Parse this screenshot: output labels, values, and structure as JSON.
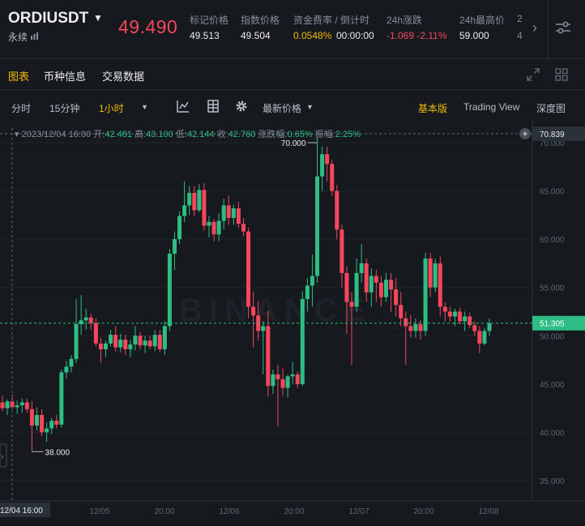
{
  "header": {
    "symbol": "ORDIUSDT",
    "contract_type": "永续",
    "last_price": "49.490",
    "stats": [
      {
        "label": "标记价格",
        "value": "49.513",
        "color": "#eaecef"
      },
      {
        "label": "指数价格",
        "value": "49.504",
        "color": "#eaecef"
      },
      {
        "label": "资金费率 / 倒计时",
        "value": "0.0548%",
        "value2": "00:00:00",
        "color": "#f0b90b"
      },
      {
        "label": "24h涨跌",
        "value": "-1.069 -2.11%",
        "color": "#f6465d"
      },
      {
        "label": "24h最高价",
        "value": "59.000",
        "color": "#eaecef"
      },
      {
        "label": "2",
        "value": "4",
        "color": "#848e9c"
      }
    ]
  },
  "tabs": [
    "图表",
    "币种信息",
    "交易数据"
  ],
  "toolbar": {
    "intervals": [
      "分时",
      "15分钟",
      "1小时"
    ],
    "price_type": "最新价格",
    "views": [
      "基本版",
      "Trading View",
      "深度图"
    ]
  },
  "ohlc": {
    "datetime": "2023/12/04 16:00",
    "open_label": "开:",
    "open": "42.481",
    "high_label": "高:",
    "high": "43.100",
    "low_label": "低:",
    "low": "42.144",
    "close_label": "收:",
    "close": "42.760",
    "change_label": "涨跌幅:",
    "change": "0.65%",
    "amplitude_label": "振幅:",
    "amplitude": "2.25%"
  },
  "chart_data": {
    "type": "candlestick",
    "watermark": "BINANCE",
    "y_ticks": [
      "70.000",
      "65.000",
      "60.000",
      "55.000",
      "50.000",
      "45.000",
      "40.000",
      "35.000"
    ],
    "ylim": [
      33.5,
      71.2
    ],
    "x_ticks": [
      "12/05",
      "20:00",
      "12/06",
      "20:00",
      "12/07",
      "20:00",
      "12/08"
    ],
    "crosshair_time": "12/04 16:00",
    "crosshair_price": "70.839",
    "last_price_tag": "51.305",
    "annotations": [
      {
        "text": "70.000",
        "price": 70.0
      },
      {
        "text": "38.000",
        "price": 38.0
      }
    ],
    "colors": {
      "up": "#2ebd85",
      "down": "#f6465d"
    },
    "candles": [
      {
        "o": 43.1,
        "h": 43.8,
        "l": 42.2,
        "c": 42.5
      },
      {
        "o": 42.5,
        "h": 43.4,
        "l": 41.8,
        "c": 43.2
      },
      {
        "o": 43.2,
        "h": 43.9,
        "l": 42.4,
        "c": 42.6
      },
      {
        "o": 42.6,
        "h": 43.3,
        "l": 41.9,
        "c": 42.8
      },
      {
        "o": 42.8,
        "h": 43.5,
        "l": 42.0,
        "c": 43.1
      },
      {
        "o": 43.1,
        "h": 43.5,
        "l": 42.0,
        "c": 42.4
      },
      {
        "o": 42.4,
        "h": 43.2,
        "l": 38.0,
        "c": 40.7
      },
      {
        "o": 40.7,
        "h": 42.6,
        "l": 40.2,
        "c": 41.8
      },
      {
        "o": 41.8,
        "h": 42.4,
        "l": 39.6,
        "c": 40.0
      },
      {
        "o": 40.0,
        "h": 41.0,
        "l": 39.0,
        "c": 40.4
      },
      {
        "o": 40.4,
        "h": 41.5,
        "l": 39.8,
        "c": 41.2
      },
      {
        "o": 41.2,
        "h": 41.8,
        "l": 40.4,
        "c": 40.8
      },
      {
        "o": 40.8,
        "h": 46.5,
        "l": 40.5,
        "c": 46.2
      },
      {
        "o": 46.2,
        "h": 47.4,
        "l": 45.6,
        "c": 46.8
      },
      {
        "o": 46.8,
        "h": 48.0,
        "l": 46.2,
        "c": 47.6
      },
      {
        "o": 47.6,
        "h": 53.8,
        "l": 47.2,
        "c": 51.2
      },
      {
        "o": 51.2,
        "h": 54.2,
        "l": 50.1,
        "c": 51.6
      },
      {
        "o": 51.6,
        "h": 52.8,
        "l": 50.6,
        "c": 51.9
      },
      {
        "o": 51.9,
        "h": 52.3,
        "l": 50.6,
        "c": 51.3
      },
      {
        "o": 51.3,
        "h": 51.8,
        "l": 48.9,
        "c": 49.2
      },
      {
        "o": 49.2,
        "h": 49.8,
        "l": 47.2,
        "c": 48.6
      },
      {
        "o": 48.6,
        "h": 49.5,
        "l": 47.8,
        "c": 49.2
      },
      {
        "o": 49.2,
        "h": 50.6,
        "l": 48.9,
        "c": 50.1
      },
      {
        "o": 50.1,
        "h": 51.0,
        "l": 48.4,
        "c": 48.8
      },
      {
        "o": 48.8,
        "h": 50.2,
        "l": 48.3,
        "c": 49.6
      },
      {
        "o": 49.6,
        "h": 50.1,
        "l": 48.0,
        "c": 48.6
      },
      {
        "o": 48.6,
        "h": 49.6,
        "l": 47.8,
        "c": 49.1
      },
      {
        "o": 49.1,
        "h": 51.0,
        "l": 48.5,
        "c": 50.0
      },
      {
        "o": 50.0,
        "h": 50.4,
        "l": 48.6,
        "c": 49.0
      },
      {
        "o": 49.0,
        "h": 50.0,
        "l": 48.2,
        "c": 49.5
      },
      {
        "o": 49.5,
        "h": 50.0,
        "l": 48.6,
        "c": 48.9
      },
      {
        "o": 48.9,
        "h": 50.6,
        "l": 48.4,
        "c": 50.1
      },
      {
        "o": 50.1,
        "h": 50.6,
        "l": 48.3,
        "c": 48.6
      },
      {
        "o": 48.6,
        "h": 51.5,
        "l": 48.0,
        "c": 51.0
      },
      {
        "o": 51.0,
        "h": 59.0,
        "l": 50.5,
        "c": 58.5
      },
      {
        "o": 58.5,
        "h": 60.8,
        "l": 56.8,
        "c": 60.0
      },
      {
        "o": 60.0,
        "h": 62.9,
        "l": 59.5,
        "c": 62.4
      },
      {
        "o": 62.4,
        "h": 66.0,
        "l": 61.8,
        "c": 63.5
      },
      {
        "o": 63.5,
        "h": 65.5,
        "l": 62.5,
        "c": 64.8
      },
      {
        "o": 64.8,
        "h": 65.5,
        "l": 62.4,
        "c": 63.0
      },
      {
        "o": 63.0,
        "h": 65.7,
        "l": 62.8,
        "c": 65.1
      },
      {
        "o": 65.1,
        "h": 65.8,
        "l": 60.9,
        "c": 61.4
      },
      {
        "o": 61.4,
        "h": 62.4,
        "l": 60.2,
        "c": 61.8
      },
      {
        "o": 61.8,
        "h": 62.1,
        "l": 59.8,
        "c": 60.5
      },
      {
        "o": 60.5,
        "h": 62.7,
        "l": 59.8,
        "c": 61.9
      },
      {
        "o": 61.9,
        "h": 64.2,
        "l": 61.0,
        "c": 63.5
      },
      {
        "o": 63.5,
        "h": 64.5,
        "l": 61.5,
        "c": 62.2
      },
      {
        "o": 62.2,
        "h": 63.6,
        "l": 61.5,
        "c": 63.2
      },
      {
        "o": 63.2,
        "h": 63.9,
        "l": 61.2,
        "c": 61.6
      },
      {
        "o": 61.6,
        "h": 62.2,
        "l": 60.3,
        "c": 60.8
      },
      {
        "o": 60.8,
        "h": 61.2,
        "l": 51.8,
        "c": 53.0
      },
      {
        "o": 53.0,
        "h": 54.6,
        "l": 48.8,
        "c": 52.1
      },
      {
        "o": 52.1,
        "h": 53.6,
        "l": 49.5,
        "c": 50.5
      },
      {
        "o": 50.5,
        "h": 51.5,
        "l": 46.0,
        "c": 51.0
      },
      {
        "o": 51.0,
        "h": 52.6,
        "l": 43.7,
        "c": 44.8
      },
      {
        "o": 44.8,
        "h": 46.5,
        "l": 44.0,
        "c": 46.0
      },
      {
        "o": 46.0,
        "h": 47.0,
        "l": 40.6,
        "c": 45.5
      },
      {
        "o": 45.5,
        "h": 46.6,
        "l": 43.8,
        "c": 44.6
      },
      {
        "o": 44.6,
        "h": 46.0,
        "l": 43.6,
        "c": 45.8
      },
      {
        "o": 45.8,
        "h": 47.3,
        "l": 45.0,
        "c": 46.0
      },
      {
        "o": 46.0,
        "h": 46.3,
        "l": 44.6,
        "c": 45.0
      },
      {
        "o": 45.0,
        "h": 54.6,
        "l": 44.8,
        "c": 53.8
      },
      {
        "o": 53.8,
        "h": 56.0,
        "l": 52.5,
        "c": 55.2
      },
      {
        "o": 55.2,
        "h": 58.4,
        "l": 53.0,
        "c": 56.2
      },
      {
        "o": 56.2,
        "h": 70.5,
        "l": 55.5,
        "c": 66.5
      },
      {
        "o": 66.5,
        "h": 69.6,
        "l": 65.0,
        "c": 68.8
      },
      {
        "o": 68.8,
        "h": 69.6,
        "l": 66.0,
        "c": 67.8
      },
      {
        "o": 67.8,
        "h": 68.2,
        "l": 64.5,
        "c": 65.0
      },
      {
        "o": 65.0,
        "h": 65.6,
        "l": 60.0,
        "c": 61.0
      },
      {
        "o": 61.0,
        "h": 61.5,
        "l": 55.0,
        "c": 56.5
      },
      {
        "o": 56.5,
        "h": 57.2,
        "l": 50.2,
        "c": 53.5
      },
      {
        "o": 53.5,
        "h": 54.5,
        "l": 47.0,
        "c": 53.0
      },
      {
        "o": 53.0,
        "h": 58.0,
        "l": 52.5,
        "c": 56.5
      },
      {
        "o": 56.5,
        "h": 59.5,
        "l": 55.5,
        "c": 57.5
      },
      {
        "o": 57.5,
        "h": 58.0,
        "l": 53.5,
        "c": 54.5
      },
      {
        "o": 54.5,
        "h": 57.0,
        "l": 53.0,
        "c": 56.2
      },
      {
        "o": 56.2,
        "h": 56.8,
        "l": 53.5,
        "c": 55.5
      },
      {
        "o": 55.5,
        "h": 56.2,
        "l": 53.0,
        "c": 54.0
      },
      {
        "o": 54.0,
        "h": 56.5,
        "l": 53.5,
        "c": 55.8
      },
      {
        "o": 55.8,
        "h": 56.5,
        "l": 52.5,
        "c": 54.8
      },
      {
        "o": 54.8,
        "h": 56.0,
        "l": 52.0,
        "c": 53.2
      },
      {
        "o": 53.2,
        "h": 54.5,
        "l": 51.0,
        "c": 51.8
      },
      {
        "o": 51.8,
        "h": 52.5,
        "l": 47.0,
        "c": 51.0
      },
      {
        "o": 51.0,
        "h": 52.2,
        "l": 49.8,
        "c": 50.5
      },
      {
        "o": 50.5,
        "h": 51.8,
        "l": 49.8,
        "c": 51.2
      },
      {
        "o": 51.2,
        "h": 51.6,
        "l": 49.6,
        "c": 50.5
      },
      {
        "o": 50.5,
        "h": 58.6,
        "l": 50.0,
        "c": 58.0
      },
      {
        "o": 58.0,
        "h": 58.6,
        "l": 54.0,
        "c": 55.0
      },
      {
        "o": 55.0,
        "h": 58.0,
        "l": 54.5,
        "c": 57.5
      },
      {
        "o": 57.5,
        "h": 58.2,
        "l": 52.0,
        "c": 53.0
      },
      {
        "o": 53.0,
        "h": 53.5,
        "l": 51.5,
        "c": 52.5
      },
      {
        "o": 52.5,
        "h": 53.0,
        "l": 51.5,
        "c": 52.0
      },
      {
        "o": 52.0,
        "h": 52.8,
        "l": 51.0,
        "c": 52.5
      },
      {
        "o": 52.5,
        "h": 52.9,
        "l": 51.2,
        "c": 51.5
      },
      {
        "o": 51.5,
        "h": 52.5,
        "l": 50.5,
        "c": 52.0
      },
      {
        "o": 52.0,
        "h": 52.4,
        "l": 50.8,
        "c": 51.1
      },
      {
        "o": 51.1,
        "h": 51.5,
        "l": 50.0,
        "c": 50.5
      },
      {
        "o": 50.5,
        "h": 51.0,
        "l": 48.2,
        "c": 49.2
      },
      {
        "o": 49.2,
        "h": 50.8,
        "l": 49.0,
        "c": 50.5
      },
      {
        "o": 50.5,
        "h": 51.8,
        "l": 50.0,
        "c": 51.3
      }
    ]
  }
}
